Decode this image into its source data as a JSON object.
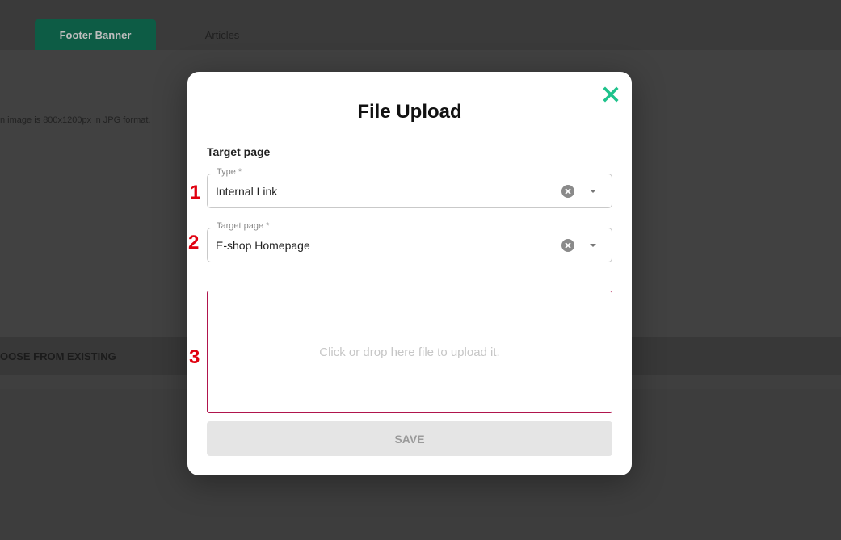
{
  "background": {
    "tabs": [
      {
        "label": "Footer Banner",
        "active": true
      },
      {
        "label": "Articles",
        "active": false
      }
    ],
    "hint_text": "n image is 800x1200px in JPG format.",
    "choose_label": "OOSE FROM EXISTING"
  },
  "modal": {
    "title": "File Upload",
    "section_label": "Target page",
    "type_field": {
      "label": "Type *",
      "value": "Internal Link"
    },
    "target_field": {
      "label": "Target page *",
      "value": "E-shop Homepage"
    },
    "dropzone_text": "Click or drop here file to upload it.",
    "save_label": "SAVE",
    "close_icon": "close-icon"
  },
  "annotations": [
    "1",
    "2",
    "3"
  ],
  "colors": {
    "accent": "#1ec28b",
    "marker": "#e0000f",
    "dropzone_border": "#b0154d"
  }
}
